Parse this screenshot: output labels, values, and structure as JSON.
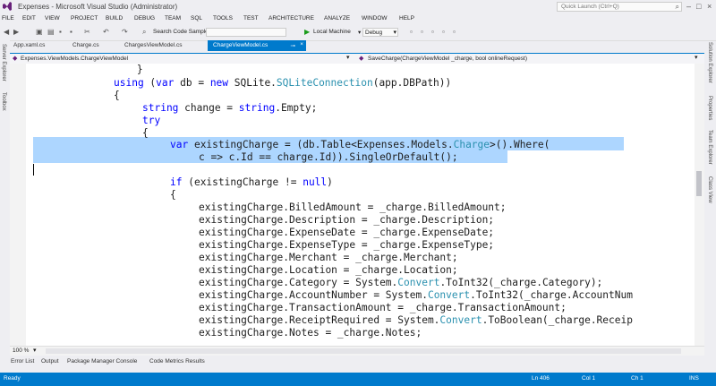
{
  "window": {
    "title": "Expenses - Microsoft Visual Studio (Administrator)",
    "quick_launch_placeholder": "Quick Launch (Ctrl+Q)"
  },
  "menu": [
    "FILE",
    "EDIT",
    "VIEW",
    "PROJECT",
    "BUILD",
    "DEBUG",
    "TEAM",
    "SQL",
    "TOOLS",
    "TEST",
    "ARCHITECTURE",
    "ANALYZE",
    "WINDOW",
    "HELP"
  ],
  "toolbar": {
    "search_code_samples": "Search Code Samples:",
    "run_target": "Local Machine",
    "configuration": "Debug"
  },
  "side_left": [
    "Server Explorer",
    "Toolbox"
  ],
  "side_right": [
    "Solution Explorer",
    "Properties",
    "Team Explorer",
    "Class View"
  ],
  "tabs": [
    "App.xaml.cs",
    "Charge.cs",
    "ChargesViewModel.cs",
    "ChargeViewModel.cs"
  ],
  "navbar": {
    "left": "Expenses.ViewModels.ChargeViewModel",
    "right": "SaveCharge(ChargeViewModel _charge, bool onlineRequest)"
  },
  "code": {
    "l1": "        }",
    "l2_kw1": "using",
    "l2_a": " (",
    "l2_kw2": "var",
    "l2_b": " db = ",
    "l2_kw3": "new",
    "l2_c": " SQLite.",
    "l2_ty": "SQLiteConnection",
    "l2_d": "(app.DBPath))",
    "l3": "{",
    "l4_kw": "string",
    "l4_a": " change = ",
    "l4_kw2": "string",
    "l4_b": ".Empty;",
    "l5": "try",
    "l6": "{",
    "l7_kw": "var",
    "l7_a": " existingCharge = (db.Table<Expenses.Models.",
    "l7_ty": "Charge",
    "l7_b": ">().Where(",
    "l8": "c => c.Id == charge.Id)).SingleOrDefault();",
    "l9_kw": "if",
    "l9_a": " (existingCharge != ",
    "l9_kw2": "null",
    "l9_b": ")",
    "l10": "{",
    "l11": "existingCharge.BilledAmount = _charge.BilledAmount;",
    "l12": "existingCharge.Description = _charge.Description;",
    "l13": "existingCharge.ExpenseDate = _charge.ExpenseDate;",
    "l14": "existingCharge.ExpenseType = _charge.ExpenseType;",
    "l15": "existingCharge.Merchant = _charge.Merchant;",
    "l16": "existingCharge.Location = _charge.Location;",
    "l17_a": "existingCharge.Category = System.",
    "l17_ty": "Convert",
    "l17_b": ".ToInt32(_charge.Category);",
    "l18_a": "existingCharge.AccountNumber = System.",
    "l18_ty": "Convert",
    "l18_b": ".ToInt32(_charge.AccountNum",
    "l19": "existingCharge.TransactionAmount = _charge.TransactionAmount;",
    "l20_a": "existingCharge.ReceiptRequired = System.",
    "l20_ty": "Convert",
    "l20_b": ".ToBoolean(_charge.Receip",
    "l21": "existingCharge.Notes = _charge.Notes;"
  },
  "zoom": "100 %",
  "bottom_tabs": [
    "Error List",
    "Output",
    "Package Manager Console",
    "Code Metrics Results"
  ],
  "status": {
    "ready": "Ready",
    "ln": "Ln 406",
    "col": "Col 1",
    "ch": "Ch 1",
    "ins": "INS"
  },
  "colors": {
    "accent": "#007acc",
    "keyword": "#0000ff",
    "type": "#2b91af",
    "selection": "#add6ff"
  }
}
